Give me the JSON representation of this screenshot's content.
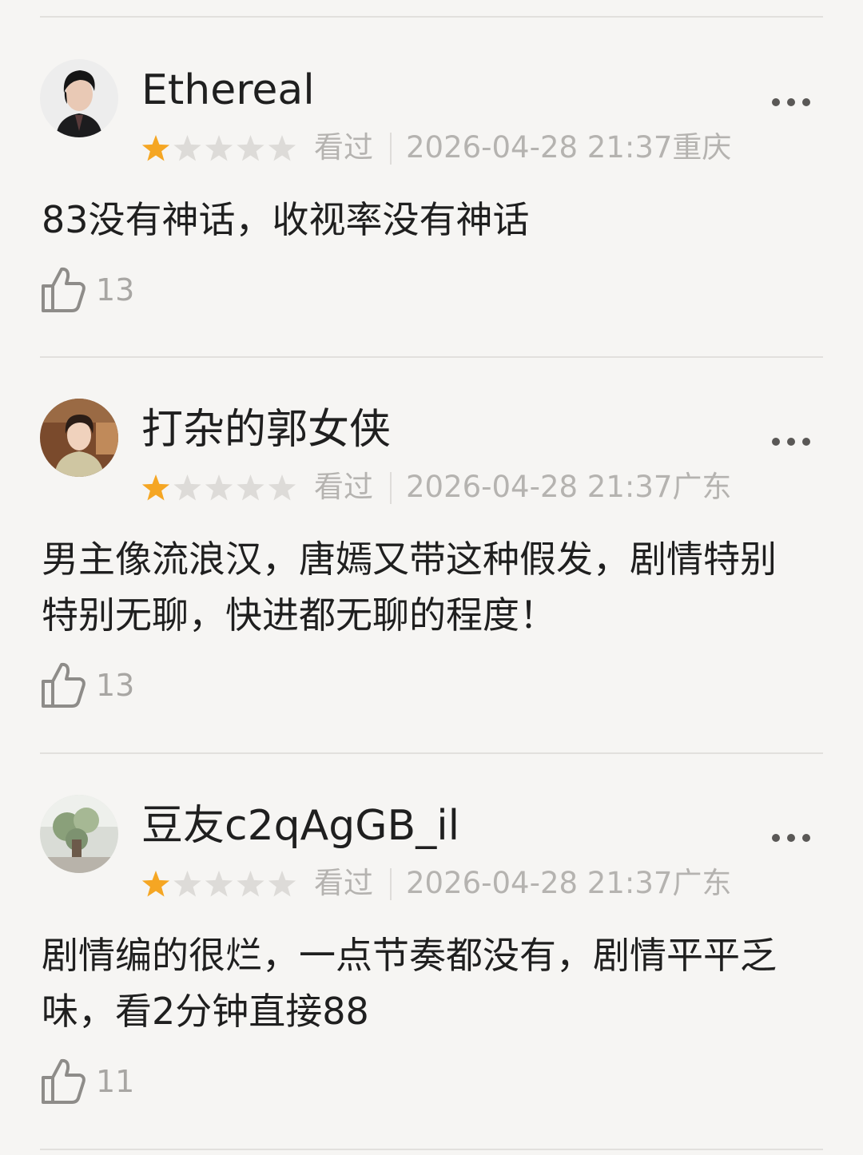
{
  "reviews": [
    {
      "user": "Ethereal",
      "rating": 1,
      "status": "看过",
      "datetime": "2026-04-28 21:37",
      "location": "重庆",
      "content": "83没有神话，收视率没有神话",
      "likes": "13"
    },
    {
      "user": "打杂的郭女侠",
      "rating": 1,
      "status": "看过",
      "datetime": "2026-04-28 21:37",
      "location": "广东",
      "content": "男主像流浪汉，唐嫣又带这种假发，剧情特别特别无聊，快进都无聊的程度！",
      "likes": "13"
    },
    {
      "user": "豆友c2qAgGB_il",
      "rating": 1,
      "status": "看过",
      "datetime": "2026-04-28 21:37",
      "location": "广东",
      "content": "剧情编的很烂，一点节奏都没有，剧情平平乏味，看2分钟直接88",
      "likes": "11"
    }
  ],
  "colors": {
    "star_filled": "#f5a623",
    "star_empty": "#dddbd8",
    "meta_text": "#b5b3b0",
    "main_text": "#1f1f1f",
    "background": "#f6f5f3"
  },
  "icons": {
    "more": "more-dots-icon",
    "like": "thumbs-up-icon",
    "star": "star-icon"
  }
}
